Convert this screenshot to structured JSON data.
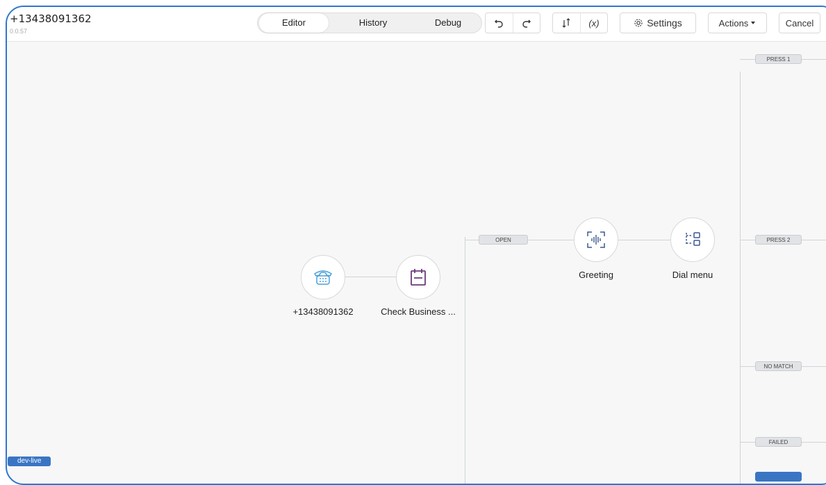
{
  "header": {
    "title": "+13438091362",
    "version": "0.0.57"
  },
  "tabs": [
    {
      "label": "Editor",
      "active": true
    },
    {
      "label": "History",
      "active": false
    },
    {
      "label": "Debug",
      "active": false
    }
  ],
  "toolbar": {
    "undo_icon": "undo-icon",
    "redo_icon": "redo-icon",
    "sort_icon": "sort-arrows-icon",
    "variables_label": "(x)",
    "settings_label": "Settings",
    "actions_label": "Actions",
    "cancel_label": "Cancel"
  },
  "flow": {
    "nodes": [
      {
        "label": "+13438091362",
        "icon": "phone-icon"
      },
      {
        "label": "Check Business ...",
        "icon": "calendar-icon"
      },
      {
        "label": "Greeting",
        "icon": "audio-wave-icon"
      },
      {
        "label": "Dial menu",
        "icon": "dial-menu-icon"
      }
    ],
    "branches": {
      "open": "OPEN",
      "press1": "PRESS 1",
      "press2": "PRESS 2",
      "no_match": "NO MATCH",
      "failed": "FAILED"
    }
  },
  "environment_badge": "dev-live",
  "colors": {
    "accent": "#2e77d0",
    "phone_icon": "#4a9fd8",
    "calendar_icon": "#6b3a7a",
    "flow_icon": "#3a5a8f"
  }
}
